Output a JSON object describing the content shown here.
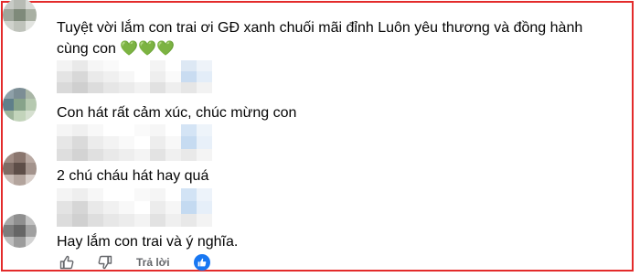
{
  "comments": [
    {
      "text": "Tuyệt vời lắm con trai ơi GĐ xanh chuối mãi đỉnh Luôn yêu thương và đồng hành cùng con",
      "emoji": "💚💚💚"
    },
    {
      "text": "Con hát rất cảm xúc, chúc mừng con"
    },
    {
      "text": "2 chú cháu hát hay quá"
    },
    {
      "text": "Hay lắm con trai và ý nghĩa."
    }
  ],
  "actions": {
    "like_icon": "thumbs-up-icon",
    "dislike_icon": "thumbs-down-icon",
    "reply_label": "Trả lời",
    "reaction_icon": "like-reaction-icon"
  },
  "colors": {
    "frame": "#e32b2b",
    "text": "#050505",
    "muted": "#65676b",
    "like_blue": "#1877f2",
    "heart_green": "#4caf50"
  }
}
